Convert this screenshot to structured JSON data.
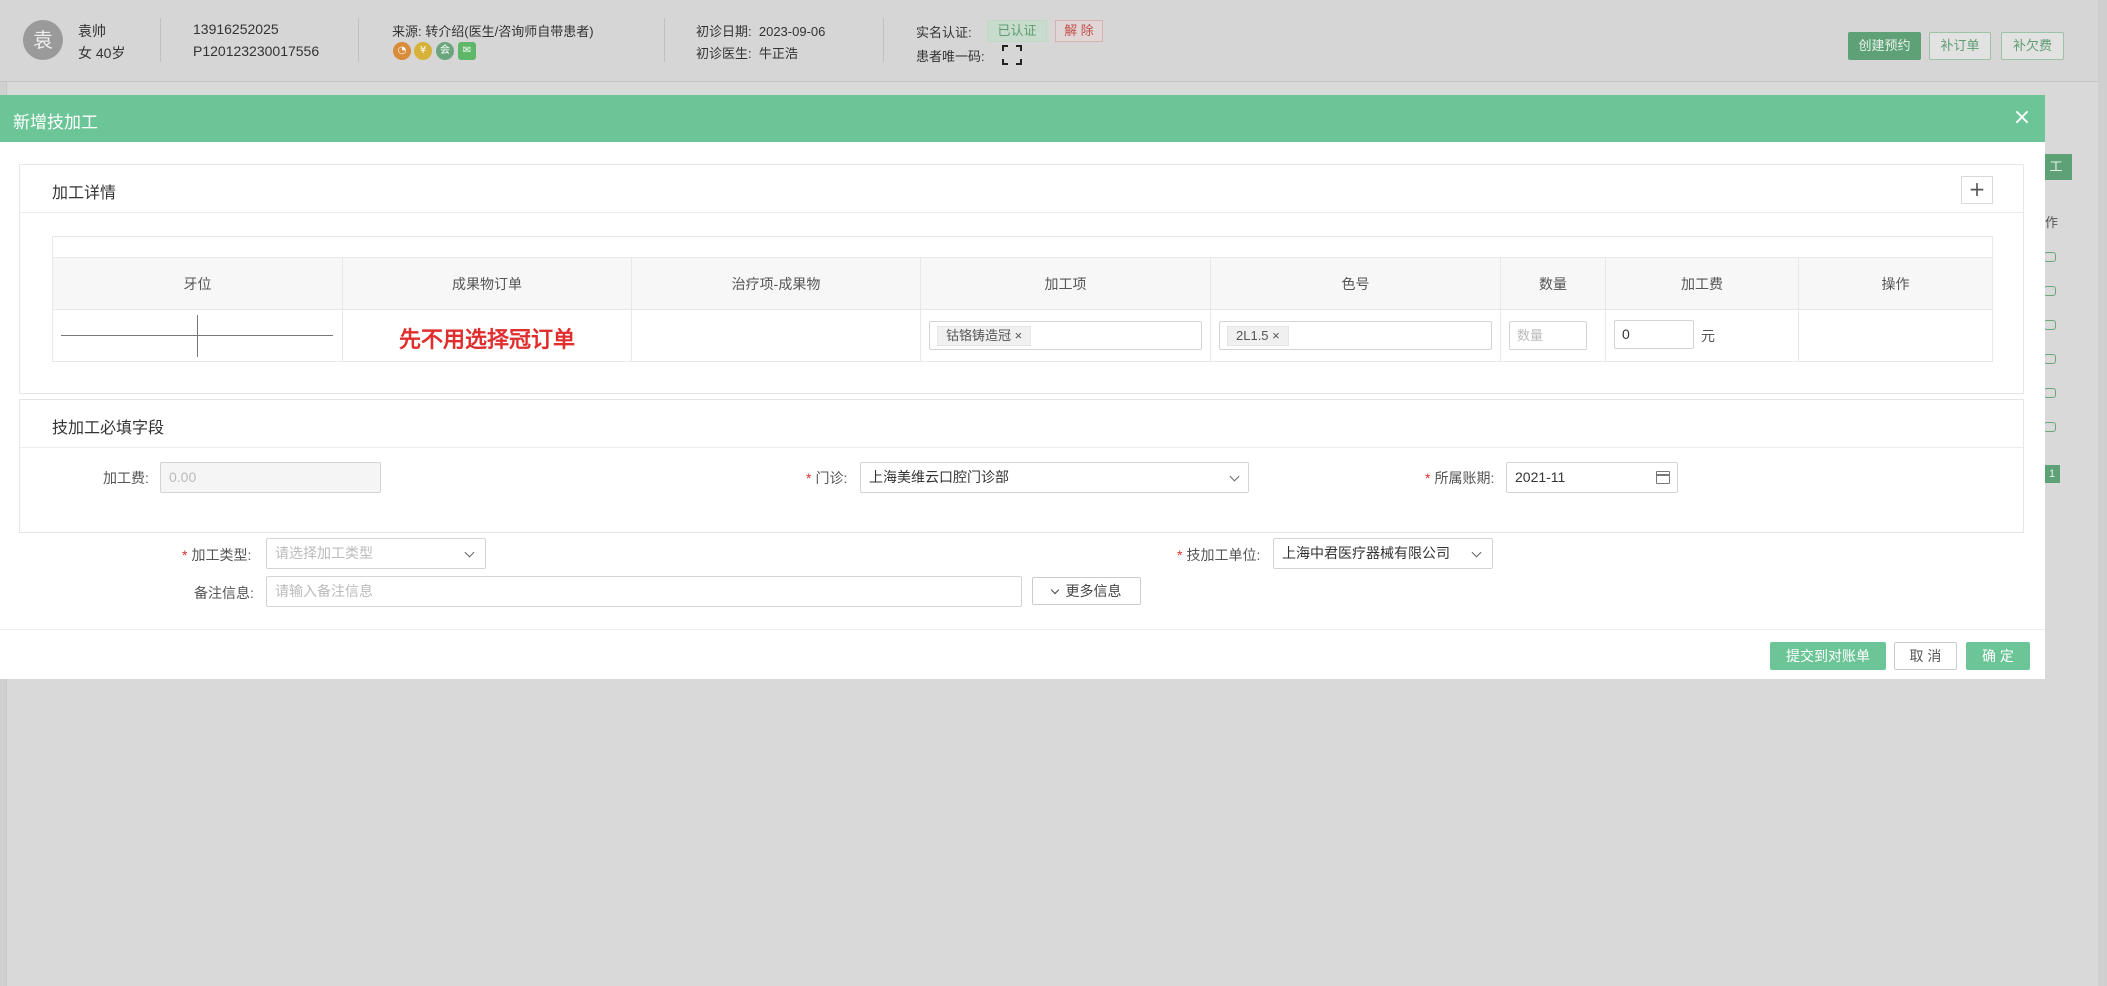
{
  "patient": {
    "avatar_char": "袁",
    "name": "袁帅",
    "gender_age": "女 40岁",
    "phone": "13916252025",
    "patient_id": "P120123230017556",
    "source_label": "来源:",
    "source_value": "转介绍(医生/咨询师自带患者)",
    "first_visit_date_label": "初诊日期:",
    "first_visit_date": "2023-09-06",
    "first_visit_doctor_label": "初诊医生:",
    "first_visit_doctor": "牛正浩",
    "realname_label": "实名认证:",
    "realname_status": "已认证",
    "realname_unbind": "解 除",
    "unique_code_label": "患者唯一码:"
  },
  "header_actions": {
    "create_appointment": "创建预约",
    "add_order": "补订单",
    "add_payment": "补欠费"
  },
  "background": {
    "right_button": "工",
    "right_column_header": "作",
    "page_number": "1"
  },
  "modal": {
    "title": "新增技加工",
    "close_symbol": "×",
    "details_panel": {
      "title": "加工详情",
      "add_symbol": "+",
      "columns": [
        "牙位",
        "成果物订单",
        "治疗项-成果物",
        "加工项",
        "色号",
        "数量",
        "加工费",
        "操作"
      ],
      "row": {
        "order_note": "先不用选择冠订单",
        "processing_item": "钴铬铸造冠 ×",
        "shade": "2L1.5 ×",
        "quantity_placeholder": "数量",
        "fee": "0",
        "fee_unit": "元"
      }
    },
    "required_panel": {
      "title": "技加工必填字段",
      "fee_label": "加工费:",
      "fee_placeholder": "0.00",
      "clinic_label": "门诊:",
      "clinic_value": "上海美维云口腔门诊部",
      "period_label": "所属账期:",
      "period_value": "2021-11"
    },
    "type_label": "加工类型:",
    "type_placeholder": "请选择加工类型",
    "unit_label": "技加工单位:",
    "unit_value": "上海中君医疗器械有限公司",
    "remark_label": "备注信息:",
    "remark_placeholder": "请输入备注信息",
    "more_info": "更多信息",
    "footer": {
      "submit_statement": "提交到对账单",
      "cancel": "取 消",
      "confirm": "确 定"
    }
  },
  "colors": {
    "brand_green": "#6cc597",
    "required_red": "#e02e2e"
  }
}
